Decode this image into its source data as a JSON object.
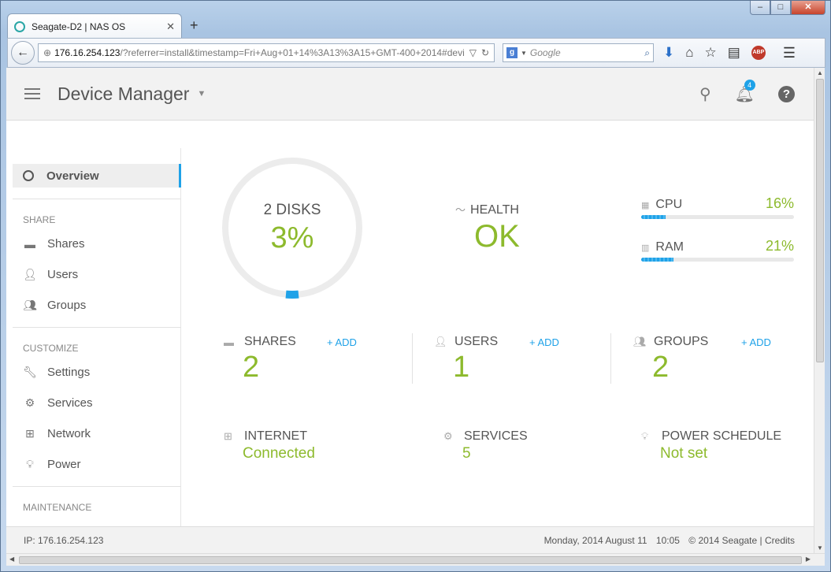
{
  "browser": {
    "tab_title": "Seagate-D2 | NAS OS",
    "url_host": "176.16.254.123",
    "url_rest": "/?referrer=install&timestamp=Fri+Aug+01+14%3A13%3A15+GMT-400+2014#devi",
    "search_placeholder": "Google"
  },
  "header": {
    "title": "Device Manager",
    "notifications": "4"
  },
  "sidebar": {
    "active": "Overview",
    "sections": [
      {
        "title": "SHARE",
        "items": [
          "Shares",
          "Users",
          "Groups"
        ]
      },
      {
        "title": "CUSTOMIZE",
        "items": [
          "Settings",
          "Services",
          "Network",
          "Power"
        ]
      },
      {
        "title": "MAINTENANCE",
        "items": []
      }
    ]
  },
  "disks": {
    "label": "2 DISKS",
    "value": "3%",
    "percent": 3
  },
  "health": {
    "label": "HEALTH",
    "value": "OK"
  },
  "cpu": {
    "label": "CPU",
    "value": "16%",
    "percent": 16
  },
  "ram": {
    "label": "RAM",
    "value": "21%",
    "percent": 21
  },
  "stats": {
    "shares": {
      "label": "SHARES",
      "value": "2",
      "add": "+ ADD"
    },
    "users": {
      "label": "USERS",
      "value": "1",
      "add": "+ ADD"
    },
    "groups": {
      "label": "GROUPS",
      "value": "2",
      "add": "+ ADD"
    }
  },
  "status": {
    "internet": {
      "label": "INTERNET",
      "value": "Connected"
    },
    "services": {
      "label": "SERVICES",
      "value": "5"
    },
    "power": {
      "label": "POWER SCHEDULE",
      "value": "Not set"
    }
  },
  "footer": {
    "ip": "IP: 176.16.254.123",
    "date": "Monday, 2014 August 11",
    "time": "10:05",
    "copyright": "© 2014 Seagate | Credits"
  },
  "colors": {
    "accent": "#8dba2d",
    "blue": "#1fa2e8"
  }
}
